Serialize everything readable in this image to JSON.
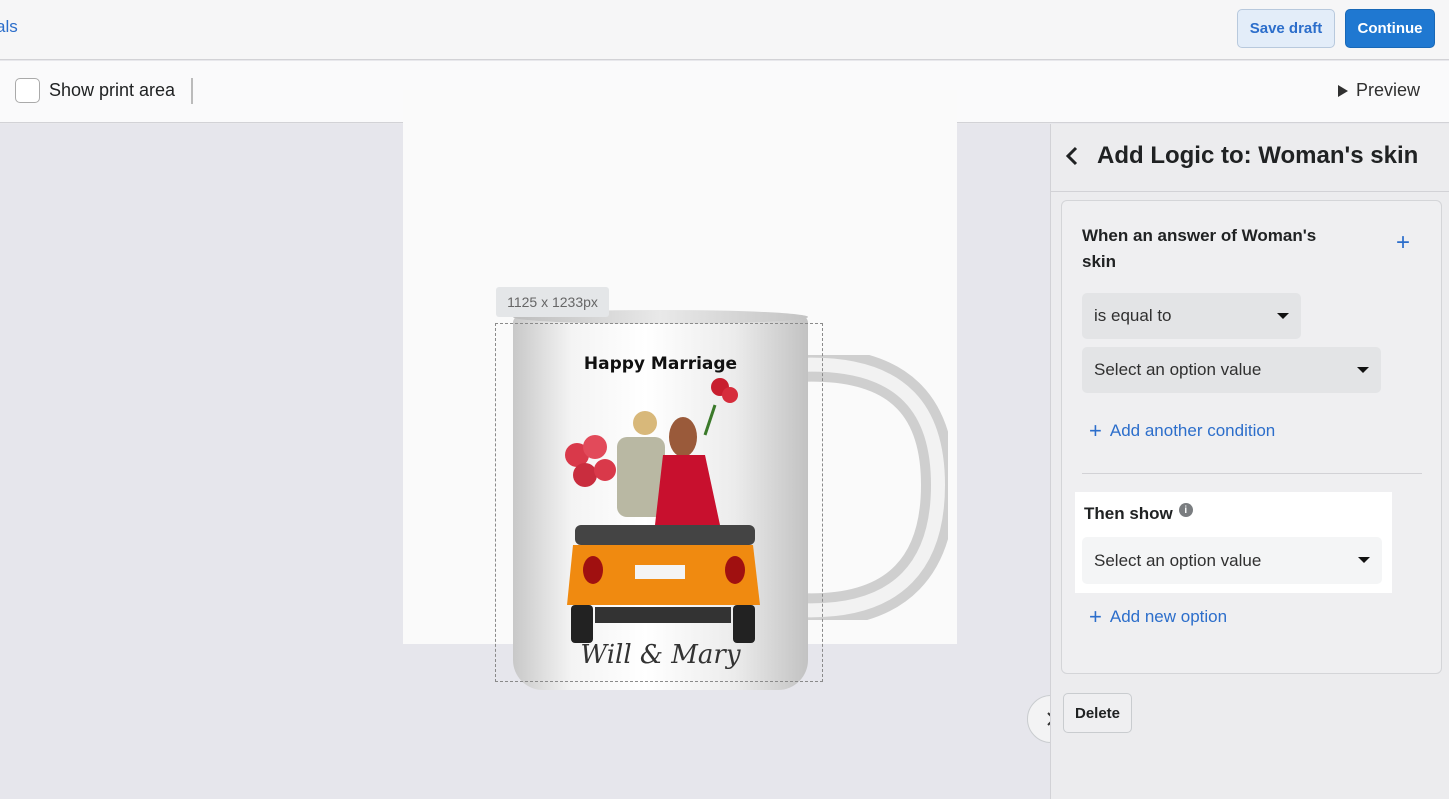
{
  "header": {
    "breadcrumb": "als",
    "save_draft_label": "Save draft",
    "continue_label": "Continue"
  },
  "toolbar": {
    "show_print_area_label": "Show print area",
    "preview_label": "Preview"
  },
  "canvas": {
    "size_tag": "1125 x 1233px",
    "mug_title": "Happy Marriage",
    "mug_signature": "Will & Mary"
  },
  "panel": {
    "title": "Add Logic to: Woman's skin",
    "condition_title": "When an answer of Woman's skin",
    "operator_value": "is equal to",
    "option_placeholder": "Select an option value",
    "add_condition_label": "Add another condition",
    "then_show_label": "Then show",
    "then_show_placeholder": "Select an option value",
    "add_option_label": "Add new option",
    "delete_label": "Delete"
  },
  "colors": {
    "accent": "#2c6ecb",
    "primary_button": "#1f78d1"
  },
  "icons": [
    "play-icon",
    "back-chevron-icon",
    "plus-icon",
    "info-icon",
    "caret-down-icon",
    "chevron-right-icon"
  ]
}
